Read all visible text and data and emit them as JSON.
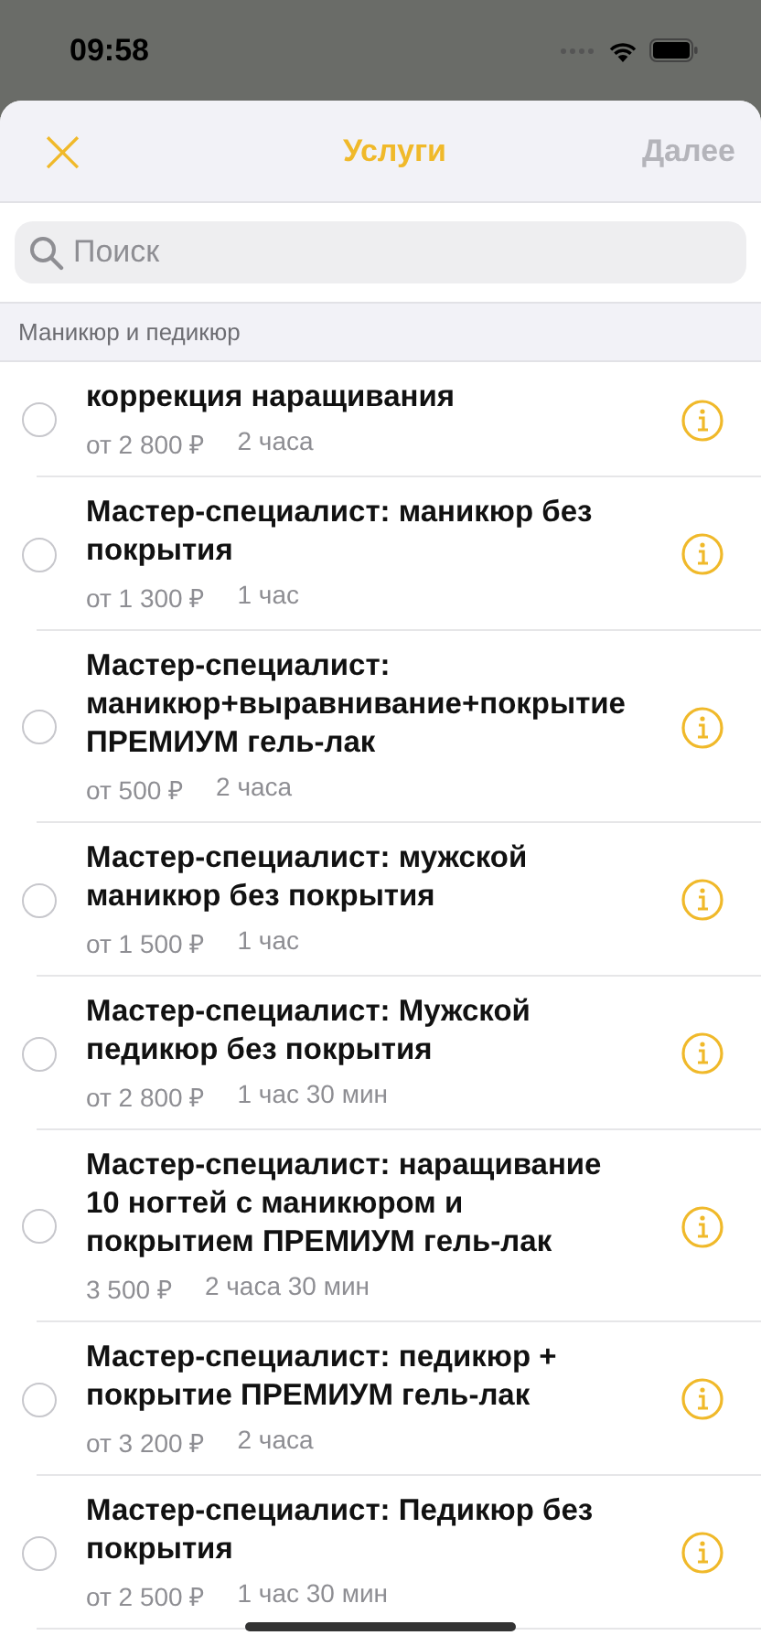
{
  "status_bar": {
    "time": "09:58"
  },
  "header": {
    "close": "×",
    "title": "Услуги",
    "next": {
      "label": "Далее",
      "disabled": true
    }
  },
  "search": {
    "placeholder": "Поиск"
  },
  "section": {
    "title": "Маникюр и педикюр"
  },
  "services": [
    {
      "name": "коррекция наращивания",
      "price": "от 2 800 ₽",
      "duration": "2 часа",
      "selected": false
    },
    {
      "name": "Мастер-специалист: маникюр без покрытия",
      "price": "от 1 300 ₽",
      "duration": "1 час",
      "selected": false
    },
    {
      "name": "Мастер-специалист: маникюр+выравнивание+покрытие ПРЕМИУМ гель-лак",
      "price": "от 500 ₽",
      "duration": "2 часа",
      "selected": false
    },
    {
      "name": "Мастер-специалист: мужской маникюр без покрытия",
      "price": "от 1 500 ₽",
      "duration": "1 час",
      "selected": false
    },
    {
      "name": "Мастер-специалист: Мужской педикюр без покрытия",
      "price": "от 2 800 ₽",
      "duration": "1 час 30 мин",
      "selected": false
    },
    {
      "name": "Мастер-специалист: наращивание 10 ногтей с маникюром и покрытием ПРЕМИУМ гель-лак",
      "price": "3 500 ₽",
      "duration": "2 часа 30 мин",
      "selected": false
    },
    {
      "name": "Мастер-специалист: педикюр + покрытие ПРЕМИУМ гель-лак",
      "price": "от 3 200 ₽",
      "duration": "2 часа",
      "selected": false
    },
    {
      "name": "Мастер-специалист: Педикюр без покрытия",
      "price": "от 2 500 ₽",
      "duration": "1 час 30 мин",
      "selected": false
    }
  ]
}
